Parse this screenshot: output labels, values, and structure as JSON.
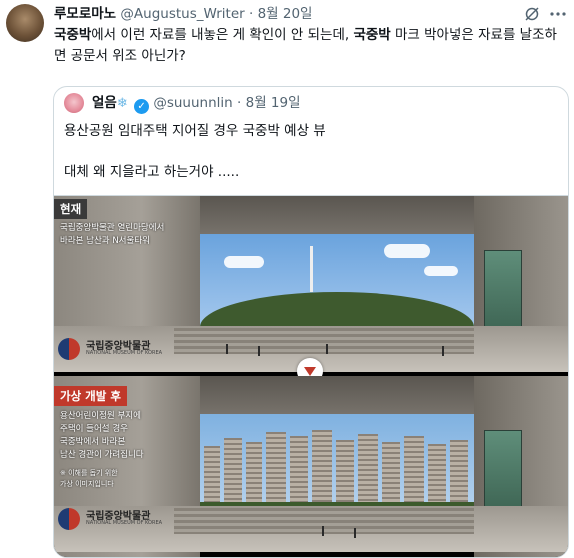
{
  "tweet": {
    "author_name": "루모로마노",
    "handle": "@Augustus_Writer",
    "date": "8월 20일",
    "separator": "·",
    "text_parts": [
      {
        "t": "국중박",
        "bold": true
      },
      {
        "t": "에서 이런 자료를 내놓은 게 확인이 안 되는데, ",
        "bold": false
      },
      {
        "t": "국중박",
        "bold": true
      },
      {
        "t": " 마크 박아넣은 자료를 날조하면 공문서 위조 아닌가?",
        "bold": false
      }
    ]
  },
  "quoted": {
    "author_name": "얼음",
    "author_emoji": "❄",
    "handle": "@suuunnlin",
    "date": "8월 19일",
    "separator": "·",
    "line1": "용산공원 임대주택 지어질 경우 국중박 예상 뷰",
    "line2": "대체 왜 지을라고 하는거야 .....",
    "image_top": {
      "label": "현재",
      "caption": [
        "국립중앙박물관 열린마당에서",
        "바라본 남산과 N서울타워"
      ],
      "logo_name": "국립중앙박물관",
      "logo_sub": "NATIONAL MUSEUM OF KOREA"
    },
    "image_bottom": {
      "label": "가상 개발 후",
      "caption": [
        "용산어린이정원 부지에",
        "주택이 들어설 경우",
        "국중박에서 바라본",
        "남산 경관이 가려집니다",
        "※ 이해를 돕기 위한",
        "가상 이미지입니다"
      ],
      "logo_name": "국립중앙박물관",
      "logo_sub": "NATIONAL MUSEUM OF KOREA"
    }
  },
  "icons": {
    "grok": "slash-circle-icon",
    "more": "more-dots-icon",
    "verified": "verified-badge-icon"
  },
  "colors": {
    "verified": "#1d9bf0",
    "meta_text": "#536471",
    "accent_red": "#c0392b"
  }
}
